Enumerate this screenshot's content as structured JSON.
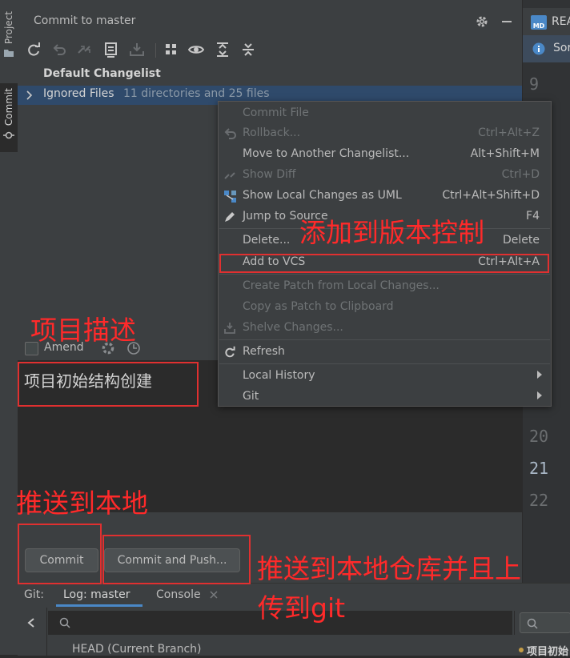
{
  "sidebar": {
    "tabs": [
      {
        "label": "Project"
      },
      {
        "label": "Commit"
      }
    ]
  },
  "commit_panel": {
    "title": "Commit to master",
    "default_changelist": "Default Changelist",
    "ignored_files": {
      "label": "Ignored Files",
      "detail": "11 directories and 25 files"
    },
    "amend_label": "Amend",
    "commit_message": "项目初始结构创建",
    "commit_button": "Commit",
    "commit_push_button": "Commit and Push..."
  },
  "context_menu": {
    "items": [
      {
        "label": "Commit File",
        "shortcut": "",
        "enabled": false
      },
      {
        "label": "Rollback...",
        "shortcut": "Ctrl+Alt+Z",
        "enabled": false
      },
      {
        "label": "Move to Another Changelist...",
        "shortcut": "Alt+Shift+M",
        "enabled": true
      },
      {
        "label": "Show Diff",
        "shortcut": "Ctrl+D",
        "enabled": false
      },
      {
        "label": "Show Local Changes as UML",
        "shortcut": "Ctrl+Alt+Shift+D",
        "enabled": true
      },
      {
        "label": "Jump to Source",
        "shortcut": "F4",
        "enabled": true
      },
      {
        "label": "Delete...",
        "shortcut": "Delete",
        "enabled": true
      },
      {
        "label": "Add to VCS",
        "shortcut": "Ctrl+Alt+A",
        "enabled": true
      },
      {
        "label": "Create Patch from Local Changes...",
        "shortcut": "",
        "enabled": false
      },
      {
        "label": "Copy as Patch to Clipboard",
        "shortcut": "",
        "enabled": false
      },
      {
        "label": "Shelve Changes...",
        "shortcut": "",
        "enabled": false
      },
      {
        "label": "Refresh",
        "shortcut": "",
        "enabled": true
      },
      {
        "label": "Local History",
        "shortcut": "",
        "enabled": true
      },
      {
        "label": "Git",
        "shortcut": "",
        "enabled": true
      }
    ]
  },
  "git_window": {
    "label": "Git:",
    "tabs": [
      {
        "label": "Log: master"
      },
      {
        "label": "Console"
      }
    ],
    "head_branch": "HEAD (Current Branch)",
    "right_commit_snippet": "项目初始"
  },
  "editor": {
    "tab_title": "REA",
    "info_text": "Sor",
    "md_badge": "MD",
    "line_numbers": [
      "9",
      "20",
      "21",
      "22"
    ]
  },
  "annotations": {
    "add_to_vcs": "添加到版本控制",
    "project_description": "项目描述",
    "push_local": "推送到本地",
    "push_remote_line1": "推送到本地仓库并且上",
    "push_remote_line2": "传到git"
  },
  "colors": {
    "annotation": "#e03030",
    "selection": "#2f4a6b",
    "accent": "#4a88c7"
  }
}
